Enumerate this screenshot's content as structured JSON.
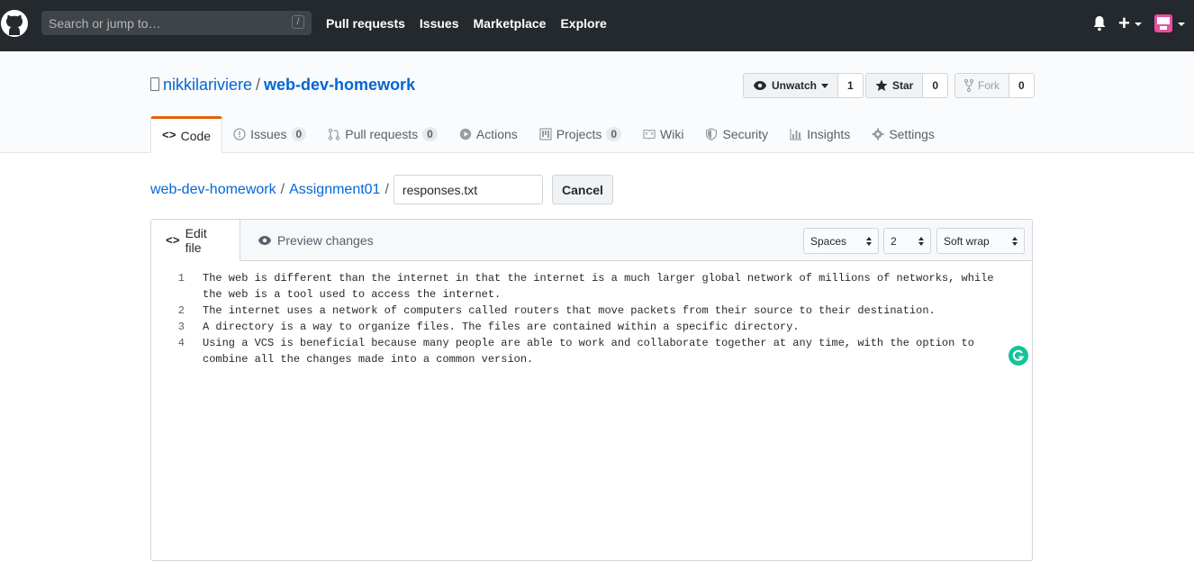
{
  "topnav": {
    "search_placeholder": "Search or jump to…",
    "search_shortcut": "/",
    "links": [
      "Pull requests",
      "Issues",
      "Marketplace",
      "Explore"
    ],
    "plus": "+"
  },
  "repo": {
    "owner": "nikkilariviere",
    "separator": "/",
    "name": "web-dev-homework",
    "watch_label": "Unwatch",
    "watch_count": "1",
    "star_label": "Star",
    "star_count": "0",
    "fork_label": "Fork",
    "fork_count": "0"
  },
  "tabs": [
    {
      "label": "Code"
    },
    {
      "label": "Issues",
      "count": "0"
    },
    {
      "label": "Pull requests",
      "count": "0"
    },
    {
      "label": "Actions"
    },
    {
      "label": "Projects",
      "count": "0"
    },
    {
      "label": "Wiki"
    },
    {
      "label": "Security"
    },
    {
      "label": "Insights"
    },
    {
      "label": "Settings"
    }
  ],
  "breadcrumb": {
    "repo": "web-dev-homework",
    "folder": "Assignment01",
    "sep": "/",
    "filename": "responses.txt",
    "cancel": "Cancel"
  },
  "editor": {
    "edit_tab": "Edit file",
    "preview_tab": "Preview changes",
    "indent_mode": "Spaces",
    "indent_size": "2",
    "wrap_mode": "Soft wrap",
    "lines": [
      {
        "num": "1",
        "text": "The web is different than the internet in that the internet is a much larger global network of millions of networks, while the web is a tool used to access the internet."
      },
      {
        "num": "2",
        "text": "The internet uses a network of computers called routers that move packets from their source to their destination."
      },
      {
        "num": "3",
        "text": "A directory is a way to organize files. The files are contained within a specific directory."
      },
      {
        "num": "4",
        "text": "Using a VCS is beneficial because many people are able to work and collaborate together at any time, with the option to combine all the changes made into a common version."
      }
    ]
  }
}
